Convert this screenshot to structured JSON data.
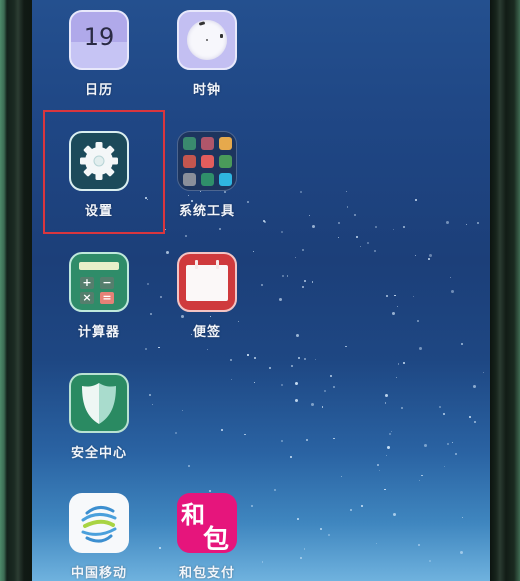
{
  "apps": [
    {
      "id": "calendar",
      "label": "日历",
      "icon": "calendar-icon",
      "date": "19"
    },
    {
      "id": "clock",
      "label": "时钟",
      "icon": "clock-icon"
    },
    {
      "id": "settings",
      "label": "设置",
      "icon": "gear-icon",
      "highlighted": true
    },
    {
      "id": "system-tools",
      "label": "系统工具",
      "icon": "folder-icon"
    },
    {
      "id": "calculator",
      "label": "计算器",
      "icon": "calculator-icon",
      "keys": [
        "+",
        "−",
        "×",
        "="
      ]
    },
    {
      "id": "notes",
      "label": "便签",
      "icon": "notepad-icon"
    },
    {
      "id": "security",
      "label": "安全中心",
      "icon": "shield-icon"
    },
    {
      "id": "china-mobile",
      "label": "中国移动",
      "icon": "china-mobile-logo-icon"
    },
    {
      "id": "hebao-pay",
      "label": "和包支付",
      "icon": "hebao-logo-icon",
      "glyphs": [
        "和",
        "包"
      ]
    }
  ],
  "highlight": {
    "target": "settings",
    "color": "#d9363e"
  },
  "folder_tiles": [
    "#3a8a6e",
    "#b0566a",
    "#e6a94c",
    "#c4564f",
    "#e25d5d",
    "#4a9a5a",
    "#8a8f9a",
    "#2f8f6a",
    "#2fb5e0"
  ]
}
